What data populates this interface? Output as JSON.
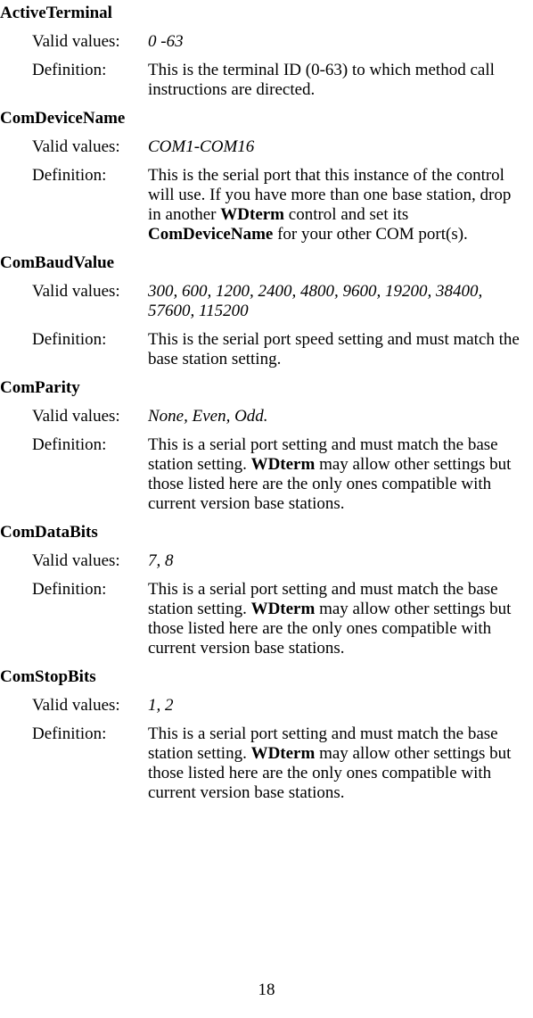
{
  "sections": [
    {
      "heading": "ActiveTerminal",
      "validValues": " 0 -63",
      "definitionParts": [
        {
          "text": "This is the terminal ID (0-63) to which method call instructions are directed.",
          "bold": false
        }
      ]
    },
    {
      "heading": "ComDeviceName",
      "validValues": "COM1-COM16",
      "definitionParts": [
        {
          "text": "This is the serial port that this instance of the control will use. If you have more than one base station, drop in another ",
          "bold": false
        },
        {
          "text": "WDterm",
          "bold": true
        },
        {
          "text": " control and set its ",
          "bold": false
        },
        {
          "text": "ComDeviceName",
          "bold": true
        },
        {
          "text": " for your other COM port(s).",
          "bold": false
        }
      ]
    },
    {
      "heading": "ComBaudValue",
      "validValues": "300, 600, 1200, 2400, 4800, 9600, 19200, 38400, 57600, 115200",
      "definitionParts": [
        {
          "text": "This is the serial port speed setting and must match the base station setting.",
          "bold": false
        }
      ]
    },
    {
      "heading": "ComParity",
      "validValues": "None, Even, Odd.",
      "definitionParts": [
        {
          "text": "This is a serial port setting and must match the base station setting. ",
          "bold": false
        },
        {
          "text": "WDterm",
          "bold": true
        },
        {
          "text": " may allow other settings but those listed here are the only ones compatible with current version base stations.",
          "bold": false
        }
      ]
    },
    {
      "heading": "ComDataBits",
      "validValues": "7, 8",
      "definitionParts": [
        {
          "text": "This is a serial port setting and must match the base station setting. ",
          "bold": false
        },
        {
          "text": "WDterm",
          "bold": true
        },
        {
          "text": " may allow other settings but those listed here are the only ones compatible with current version base stations.",
          "bold": false
        }
      ]
    },
    {
      "heading": "ComStopBits",
      "validValues": "1, 2",
      "definitionParts": [
        {
          "text": "This is a serial port setting and must match the base station setting. ",
          "bold": false
        },
        {
          "text": "WDterm",
          "bold": true
        },
        {
          "text": " may allow other settings but those listed here are the only ones compatible with current version base stations.",
          "bold": false
        }
      ]
    }
  ],
  "labels": {
    "validValues": "Valid values:",
    "definition": "Definition:"
  },
  "pageNumber": "18"
}
